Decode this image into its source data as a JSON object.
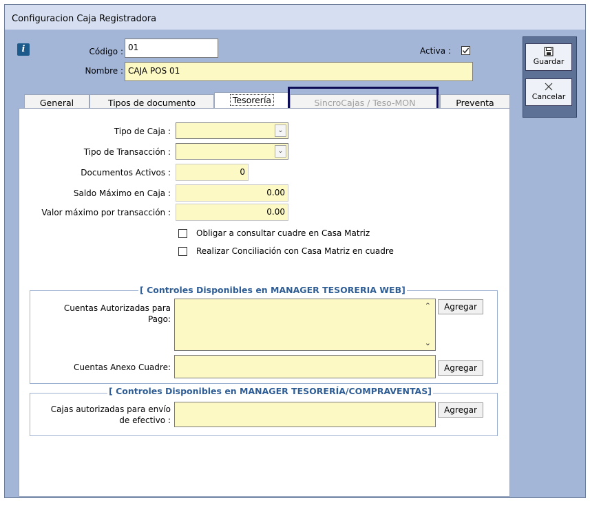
{
  "window": {
    "title": "Configuracion  Caja  Registradora"
  },
  "header": {
    "codigo_label": "Código :",
    "codigo_value": "01",
    "activa_label": "Activa :",
    "nombre_label": "Nombre :",
    "nombre_value": "CAJA POS 01"
  },
  "side_buttons": {
    "save_label": "Guardar",
    "cancel_label": "Cancelar"
  },
  "tabs": [
    {
      "label": "General"
    },
    {
      "label": "Tipos de documento"
    },
    {
      "label": "Tesorería"
    },
    {
      "label": "SincroCajas / Teso-MON"
    },
    {
      "label": "Preventa"
    }
  ],
  "form": {
    "tipo_caja_label": "Tipo de Caja :",
    "tipo_transaccion_label": "Tipo de Transacción :",
    "documentos_activos_label": "Documentos  Activos :",
    "documentos_activos_value": "0",
    "saldo_maximo_label": "Saldo Máximo en Caja :",
    "saldo_maximo_value": "0.00",
    "valor_maximo_label": "Valor máximo por transacción :",
    "valor_maximo_value": "0.00",
    "check1_label": "Obligar a consultar cuadre en Casa Matriz",
    "check2_label": "Realizar Conciliación con Casa Matriz en cuadre"
  },
  "group1": {
    "legend": "[ Controles Disponibles en MANAGER TESORERIA WEB]",
    "cuentas_pago_label_1": "Cuentas Autorizadas para",
    "cuentas_pago_label_2": "Pago:",
    "cuentas_anexo_label": "Cuentas Anexo Cuadre:",
    "agregar_label": "Agregar"
  },
  "group2": {
    "legend": "[ Controles Disponibles en MANAGER TESORERÍA/COMPRAVENTAS]",
    "cajas_label_1": "Cajas autorizadas para envío",
    "cajas_label_2": "de efectivo :",
    "agregar_label": "Agregar"
  },
  "colors": {
    "frame": "#a3b6d8",
    "titlebar": "#d5dff1",
    "field_yellow": "#fdf9c5",
    "legend_blue": "#2f5e96",
    "highlight_box": "#0d0d55"
  }
}
